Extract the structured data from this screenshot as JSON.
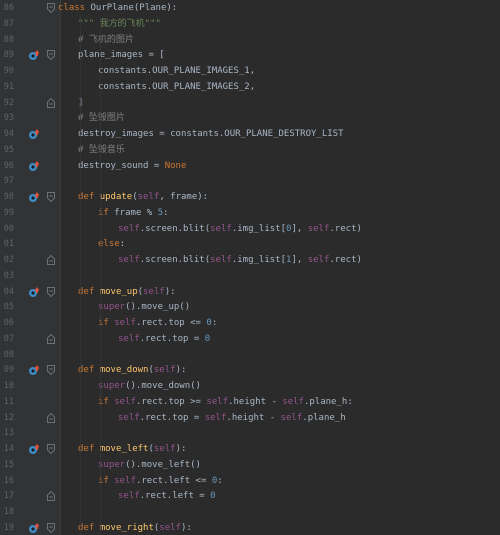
{
  "editor": {
    "lines": [
      {
        "num": "86",
        "indent": 0,
        "fold": "open",
        "marker": "none",
        "tokens": [
          {
            "t": "class ",
            "c": "kw"
          },
          {
            "t": "OurPlane",
            "c": "cls"
          },
          {
            "t": "(Plane):",
            "c": ""
          }
        ]
      },
      {
        "num": "87",
        "indent": 1,
        "fold": "none",
        "marker": "none",
        "tokens": [
          {
            "t": "\"\"\" 我方的飞机\"\"\"",
            "c": "str"
          }
        ]
      },
      {
        "num": "88",
        "indent": 1,
        "fold": "none",
        "marker": "none",
        "tokens": [
          {
            "t": "# 飞机的图片",
            "c": "cmt"
          }
        ]
      },
      {
        "num": "89",
        "indent": 1,
        "fold": "open",
        "marker": "override",
        "tokens": [
          {
            "t": "plane_images = [",
            "c": ""
          }
        ]
      },
      {
        "num": "90",
        "indent": 2,
        "fold": "none",
        "marker": "none",
        "tokens": [
          {
            "t": "constants.OUR_PLANE_IMAGES_1,",
            "c": ""
          }
        ]
      },
      {
        "num": "91",
        "indent": 2,
        "fold": "none",
        "marker": "none",
        "tokens": [
          {
            "t": "constants.OUR_PLANE_IMAGES_2,",
            "c": ""
          }
        ]
      },
      {
        "num": "92",
        "indent": 1,
        "fold": "close",
        "marker": "none",
        "tokens": [
          {
            "t": "]",
            "c": ""
          }
        ]
      },
      {
        "num": "93",
        "indent": 1,
        "fold": "none",
        "marker": "none",
        "tokens": [
          {
            "t": "# 坠毁图片",
            "c": "cmt"
          }
        ]
      },
      {
        "num": "94",
        "indent": 1,
        "fold": "none",
        "marker": "override",
        "tokens": [
          {
            "t": "destroy_images = constants.OUR_PLANE_DESTROY_LIST",
            "c": ""
          }
        ]
      },
      {
        "num": "95",
        "indent": 1,
        "fold": "none",
        "marker": "none",
        "tokens": [
          {
            "t": "# 坠毁音乐",
            "c": "cmt"
          }
        ]
      },
      {
        "num": "96",
        "indent": 1,
        "fold": "none",
        "marker": "override",
        "tokens": [
          {
            "t": "destroy_sound = ",
            "c": ""
          },
          {
            "t": "None",
            "c": "kw"
          }
        ]
      },
      {
        "num": "97",
        "indent": 0,
        "fold": "none",
        "marker": "none",
        "tokens": []
      },
      {
        "num": "98",
        "indent": 1,
        "fold": "open",
        "marker": "override",
        "tokens": [
          {
            "t": "def ",
            "c": "kw"
          },
          {
            "t": "update",
            "c": "fn"
          },
          {
            "t": "(",
            "c": ""
          },
          {
            "t": "self",
            "c": "self"
          },
          {
            "t": ", frame):",
            "c": ""
          }
        ]
      },
      {
        "num": "99",
        "indent": 2,
        "fold": "none",
        "marker": "none",
        "tokens": [
          {
            "t": "if ",
            "c": "kw"
          },
          {
            "t": "frame % ",
            "c": ""
          },
          {
            "t": "5",
            "c": "num"
          },
          {
            "t": ":",
            "c": ""
          }
        ]
      },
      {
        "num": "00",
        "indent": 3,
        "fold": "none",
        "marker": "none",
        "tokens": [
          {
            "t": "self",
            "c": "self"
          },
          {
            "t": ".screen.blit(",
            "c": ""
          },
          {
            "t": "self",
            "c": "self"
          },
          {
            "t": ".img_list[",
            "c": ""
          },
          {
            "t": "0",
            "c": "num"
          },
          {
            "t": "], ",
            "c": ""
          },
          {
            "t": "self",
            "c": "self"
          },
          {
            "t": ".rect)",
            "c": ""
          }
        ]
      },
      {
        "num": "01",
        "indent": 2,
        "fold": "none",
        "marker": "none",
        "tokens": [
          {
            "t": "else",
            "c": "kw"
          },
          {
            "t": ":",
            "c": ""
          }
        ]
      },
      {
        "num": "02",
        "indent": 3,
        "fold": "close",
        "marker": "none",
        "tokens": [
          {
            "t": "self",
            "c": "self"
          },
          {
            "t": ".screen.blit(",
            "c": ""
          },
          {
            "t": "self",
            "c": "self"
          },
          {
            "t": ".img_list[",
            "c": ""
          },
          {
            "t": "1",
            "c": "num"
          },
          {
            "t": "], ",
            "c": ""
          },
          {
            "t": "self",
            "c": "self"
          },
          {
            "t": ".rect)",
            "c": ""
          }
        ]
      },
      {
        "num": "03",
        "indent": 0,
        "fold": "none",
        "marker": "none",
        "tokens": []
      },
      {
        "num": "04",
        "indent": 1,
        "fold": "open",
        "marker": "override",
        "tokens": [
          {
            "t": "def ",
            "c": "kw"
          },
          {
            "t": "move_up",
            "c": "fn"
          },
          {
            "t": "(",
            "c": ""
          },
          {
            "t": "self",
            "c": "self"
          },
          {
            "t": "):",
            "c": ""
          }
        ]
      },
      {
        "num": "05",
        "indent": 2,
        "fold": "none",
        "marker": "none",
        "tokens": [
          {
            "t": "super",
            "c": "self"
          },
          {
            "t": "().move_up()",
            "c": ""
          }
        ]
      },
      {
        "num": "06",
        "indent": 2,
        "fold": "none",
        "marker": "none",
        "tokens": [
          {
            "t": "if ",
            "c": "kw"
          },
          {
            "t": "self",
            "c": "self"
          },
          {
            "t": ".rect.top <= ",
            "c": ""
          },
          {
            "t": "0",
            "c": "num"
          },
          {
            "t": ":",
            "c": ""
          }
        ]
      },
      {
        "num": "07",
        "indent": 3,
        "fold": "close",
        "marker": "none",
        "tokens": [
          {
            "t": "self",
            "c": "self"
          },
          {
            "t": ".rect.top = ",
            "c": ""
          },
          {
            "t": "0",
            "c": "num"
          }
        ]
      },
      {
        "num": "08",
        "indent": 0,
        "fold": "none",
        "marker": "none",
        "tokens": []
      },
      {
        "num": "09",
        "indent": 1,
        "fold": "open",
        "marker": "override",
        "tokens": [
          {
            "t": "def ",
            "c": "kw"
          },
          {
            "t": "move_down",
            "c": "fn"
          },
          {
            "t": "(",
            "c": ""
          },
          {
            "t": "self",
            "c": "self"
          },
          {
            "t": "):",
            "c": ""
          }
        ]
      },
      {
        "num": "10",
        "indent": 2,
        "fold": "none",
        "marker": "none",
        "tokens": [
          {
            "t": "super",
            "c": "self"
          },
          {
            "t": "().move_down()",
            "c": ""
          }
        ]
      },
      {
        "num": "11",
        "indent": 2,
        "fold": "none",
        "marker": "none",
        "tokens": [
          {
            "t": "if ",
            "c": "kw"
          },
          {
            "t": "self",
            "c": "self"
          },
          {
            "t": ".rect.top >= ",
            "c": ""
          },
          {
            "t": "self",
            "c": "self"
          },
          {
            "t": ".height - ",
            "c": ""
          },
          {
            "t": "self",
            "c": "self"
          },
          {
            "t": ".plane_h:",
            "c": ""
          }
        ]
      },
      {
        "num": "12",
        "indent": 3,
        "fold": "close",
        "marker": "none",
        "tokens": [
          {
            "t": "self",
            "c": "self"
          },
          {
            "t": ".rect.top = ",
            "c": ""
          },
          {
            "t": "self",
            "c": "self"
          },
          {
            "t": ".height - ",
            "c": ""
          },
          {
            "t": "self",
            "c": "self"
          },
          {
            "t": ".plane_h",
            "c": ""
          }
        ]
      },
      {
        "num": "13",
        "indent": 0,
        "fold": "none",
        "marker": "none",
        "tokens": []
      },
      {
        "num": "14",
        "indent": 1,
        "fold": "open",
        "marker": "override",
        "tokens": [
          {
            "t": "def ",
            "c": "kw"
          },
          {
            "t": "move_left",
            "c": "fn"
          },
          {
            "t": "(",
            "c": ""
          },
          {
            "t": "self",
            "c": "self"
          },
          {
            "t": "):",
            "c": ""
          }
        ]
      },
      {
        "num": "15",
        "indent": 2,
        "fold": "none",
        "marker": "none",
        "tokens": [
          {
            "t": "super",
            "c": "self"
          },
          {
            "t": "().move_left()",
            "c": ""
          }
        ]
      },
      {
        "num": "16",
        "indent": 2,
        "fold": "none",
        "marker": "none",
        "tokens": [
          {
            "t": "if ",
            "c": "kw"
          },
          {
            "t": "self",
            "c": "self"
          },
          {
            "t": ".rect.left <= ",
            "c": ""
          },
          {
            "t": "0",
            "c": "num"
          },
          {
            "t": ":",
            "c": ""
          }
        ]
      },
      {
        "num": "17",
        "indent": 3,
        "fold": "close",
        "marker": "none",
        "tokens": [
          {
            "t": "self",
            "c": "self"
          },
          {
            "t": ".rect.left = ",
            "c": ""
          },
          {
            "t": "0",
            "c": "num"
          }
        ]
      },
      {
        "num": "18",
        "indent": 0,
        "fold": "none",
        "marker": "none",
        "tokens": []
      },
      {
        "num": "19",
        "indent": 1,
        "fold": "open",
        "marker": "override",
        "tokens": [
          {
            "t": "def ",
            "c": "kw"
          },
          {
            "t": "move_right",
            "c": "fn"
          },
          {
            "t": "(",
            "c": ""
          },
          {
            "t": "self",
            "c": "self"
          },
          {
            "t": "):",
            "c": ""
          }
        ]
      }
    ]
  },
  "colors": {
    "background": "#2b2b2b",
    "gutter": "#313335",
    "keyword": "#cc7832",
    "self": "#94558d",
    "function": "#ffc66d",
    "string": "#6a8759",
    "comment": "#808080",
    "number": "#6897bb",
    "text": "#a9b7c6",
    "override_marker_circle": "#3d8ec9",
    "override_marker_arrow": "#e0533d"
  }
}
